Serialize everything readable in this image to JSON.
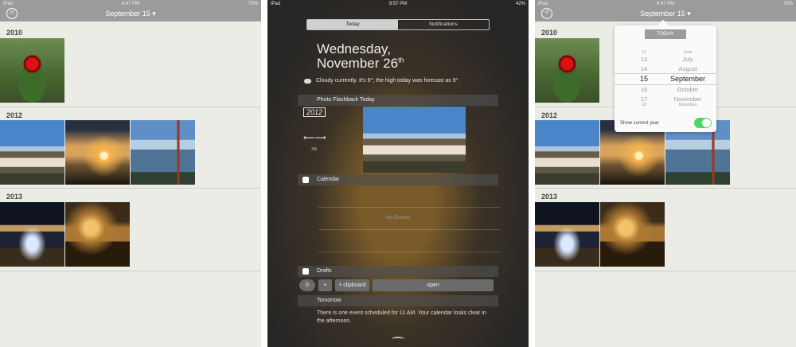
{
  "left_panel": {
    "status": {
      "carrier": "iPad",
      "time": "4:47 PM",
      "battery": "79%"
    },
    "title": "September 15 ▾",
    "years": [
      "2010",
      "2012",
      "2013"
    ]
  },
  "center_panel": {
    "status": {
      "carrier": "iPad",
      "time": "8:57 PM",
      "battery": "42%"
    },
    "tabs": [
      {
        "label": "Today",
        "active": true
      },
      {
        "label": "Notifications",
        "active": false
      }
    ],
    "date_line1": "Wednesday,",
    "date_line2": "November 26",
    "date_suffix": "th",
    "weather_text": "Cloudy currently. It's 9°; the high today was forecast as 9°.",
    "photo_flashback_title": "Photo Flashback Today",
    "flashback_year": "2012",
    "arrows": "⟵⟶",
    "counter": "3/8",
    "calendar_title": "Calendar",
    "no_events": "No Events",
    "drafts_title": "Drafts",
    "drafts_buttons": {
      "count": "0",
      "plus": "+",
      "clipboard": "+ clipboard",
      "open": "open"
    },
    "tomorrow_title": "Tomorrow",
    "tomorrow_text": "There is one event scheduled for 11 AM. Your calendar looks clear in the afternoon."
  },
  "right_panel": {
    "status": {
      "carrier": "iPad",
      "time": "4:47 PM",
      "battery": "79%"
    },
    "title": "September 15 ▾",
    "years": [
      "2010",
      "2012",
      "2013"
    ],
    "today_button": "TODAY",
    "picker_days": [
      "12",
      "13",
      "14",
      "15",
      "16",
      "17",
      "18"
    ],
    "picker_months": [
      "June",
      "July",
      "August",
      "September",
      "October",
      "November",
      "December"
    ],
    "show_current_year": "Show current year",
    "toggle_on": true
  }
}
